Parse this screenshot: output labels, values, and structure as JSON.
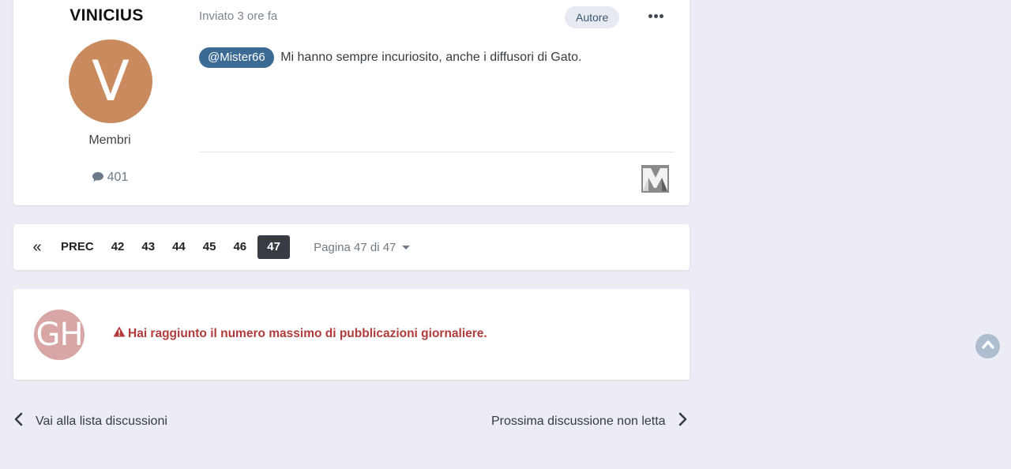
{
  "post": {
    "author_name": "VINICIUS",
    "avatar_letter": "V",
    "avatar_color": "#c98a5e",
    "group": "Membri",
    "post_count": "401",
    "posted": "Inviato 3 ore fa",
    "author_badge": "Autore",
    "mention": "@Mister66",
    "body": "Mi hanno sempre incuriosito, anche i diffusori di Gato."
  },
  "pagination": {
    "first_icon": "«",
    "prev_label": "PREC",
    "pages": [
      "42",
      "43",
      "44",
      "45",
      "46",
      "47"
    ],
    "current_page": "47",
    "page_jump": "Pagina 47 di 47"
  },
  "reply": {
    "avatar_initials": "GH",
    "avatar_color": "#d9a6a6",
    "limit_message": "Hai raggiunto il numero massimo di pubblicazioni giornaliere."
  },
  "navigation": {
    "prev_label": "Vai alla lista discussioni",
    "next_label": "Prossima discussione non letta"
  },
  "colors": {
    "background": "#ebecf4",
    "mention_bg": "#3b6a94",
    "error": "#b13b3b",
    "active_page": "#383c42",
    "scroll_top": "#aebdd0"
  },
  "icons": {
    "more": "ellipsis-icon",
    "post_count": "comment-icon",
    "warning": "warning-triangle-icon",
    "prev": "chevron-left-icon",
    "next": "chevron-right-icon",
    "scroll_top": "chevron-up-circle-icon"
  }
}
